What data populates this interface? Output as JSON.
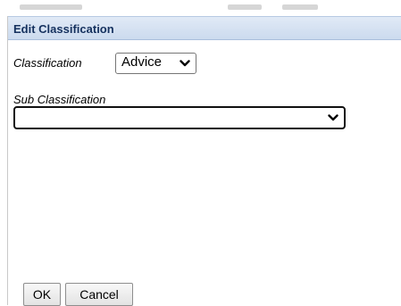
{
  "dialog": {
    "title": "Edit Classification"
  },
  "classification": {
    "label": "Classification",
    "selected": "Advice"
  },
  "sub_classification": {
    "label": "Sub Classification",
    "selected": ""
  },
  "buttons": {
    "ok_label": "OK",
    "cancel_label": "Cancel"
  },
  "icons": {
    "dropdown": "chevron-down-icon"
  },
  "colors": {
    "titlebar": "#cbdaee",
    "title_text": "#15315e"
  }
}
